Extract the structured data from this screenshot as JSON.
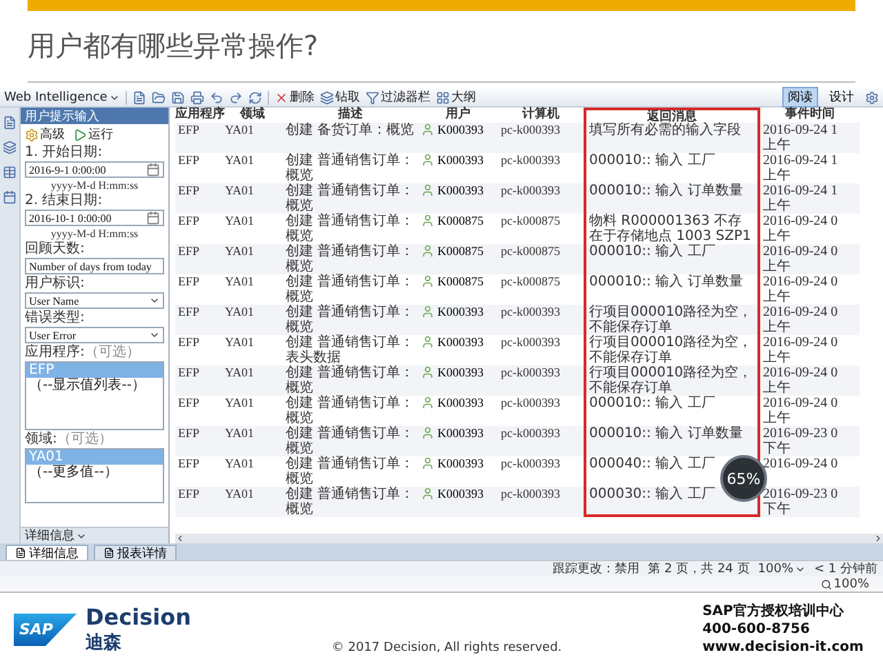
{
  "slide": {
    "title": "用户都有哪些异常操作?"
  },
  "app": {
    "toolbar": {
      "product": "Web Intelligence",
      "actions": [
        "删除",
        "钻取",
        "过滤器栏",
        "大纲"
      ],
      "views": [
        {
          "label": "阅读",
          "selected": true
        },
        {
          "label": "设计",
          "selected": false
        }
      ]
    },
    "prompt_panel": {
      "title": "用户提示输入",
      "buttons": [
        "高级",
        "运行"
      ],
      "date_fields": [
        {
          "label": "1. 开始日期:",
          "value": "2016-9-1 0:00:00",
          "hint": "yyyy-M-d H:mm:ss"
        },
        {
          "label": "2. 结束日期:",
          "value": "2016-10-1 0:00:00",
          "hint": "yyyy-M-d H:mm:ss"
        }
      ],
      "text_field": {
        "label": "回顾天数:",
        "value": "Number of days from today"
      },
      "selects": [
        {
          "label": "用户标识:",
          "value": "User Name"
        },
        {
          "label": "错误类型:",
          "value": "User Error"
        }
      ],
      "lists": [
        {
          "label": "应用程序:",
          "optional": "（可选）",
          "items": [
            {
              "text": "EFP",
              "selected": true
            },
            {
              "text": "（--显示值列表--）",
              "selected": false
            }
          ]
        },
        {
          "label": "领域:",
          "optional": "（可选）",
          "items": [
            {
              "text": "YA01",
              "selected": true
            },
            {
              "text": "（--更多值--）",
              "selected": false
            }
          ]
        }
      ],
      "footer": "详细信息"
    },
    "table": {
      "columns": [
        "应用程序",
        "领域",
        "描述",
        "用户",
        "计算机",
        "返回消息",
        "事件时间"
      ],
      "rows": [
        {
          "app": "EFP",
          "area": "YA01",
          "description": "创建 备货订单：概览",
          "user": "K000393",
          "computer": "pc-k000393",
          "message": "填写所有必需的输入字段",
          "time": "2016-09-24 1\n上午"
        },
        {
          "app": "EFP",
          "area": "YA01",
          "description": "创建 普通销售订单：概览",
          "user": "K000393",
          "computer": "pc-k000393",
          "message": "000010:: 输入 工厂",
          "time": "2016-09-24 1\n上午"
        },
        {
          "app": "EFP",
          "area": "YA01",
          "description": "创建 普通销售订单：概览",
          "user": "K000393",
          "computer": "pc-k000393",
          "message": "000010:: 输入 订单数量",
          "time": "2016-09-24 1\n上午"
        },
        {
          "app": "EFP",
          "area": "YA01",
          "description": "创建 普通销售订单：概览",
          "user": "K000875",
          "computer": "pc-k000875",
          "message": "物料 R000001363 不存在于存储地点 1003 SZP1",
          "time": "2016-09-24 0\n上午"
        },
        {
          "app": "EFP",
          "area": "YA01",
          "description": "创建 普通销售订单：概览",
          "user": "K000875",
          "computer": "pc-k000875",
          "message": "000010:: 输入 工厂",
          "time": "2016-09-24 0\n上午"
        },
        {
          "app": "EFP",
          "area": "YA01",
          "description": "创建 普通销售订单：概览",
          "user": "K000875",
          "computer": "pc-k000875",
          "message": "000010:: 输入 订单数量",
          "time": "2016-09-24 0\n上午"
        },
        {
          "app": "EFP",
          "area": "YA01",
          "description": "创建 普通销售订单：概览",
          "user": "K000393",
          "computer": "pc-k000393",
          "message": "行项目000010路径为空，不能保存订单",
          "time": "2016-09-24 0\n上午"
        },
        {
          "app": "EFP",
          "area": "YA01",
          "description": "创建 普通销售订单：表头数据",
          "user": "K000393",
          "computer": "pc-k000393",
          "message": "行项目000010路径为空，不能保存订单",
          "time": "2016-09-24 0\n上午"
        },
        {
          "app": "EFP",
          "area": "YA01",
          "description": "创建 普通销售订单：概览",
          "user": "K000393",
          "computer": "pc-k000393",
          "message": "行项目000010路径为空，不能保存订单",
          "time": "2016-09-24 0\n上午"
        },
        {
          "app": "EFP",
          "area": "YA01",
          "description": "创建 普通销售订单：概览",
          "user": "K000393",
          "computer": "pc-k000393",
          "message": "000010:: 输入 工厂",
          "time": "2016-09-24 0\n上午"
        },
        {
          "app": "EFP",
          "area": "YA01",
          "description": "创建 普通销售订单：概览",
          "user": "K000393",
          "computer": "pc-k000393",
          "message": "000010:: 输入 订单数量",
          "time": "2016-09-23 0\n下午"
        },
        {
          "app": "EFP",
          "area": "YA01",
          "description": "创建 普通销售订单：概览",
          "user": "K000393",
          "computer": "pc-k000393",
          "message": "000040:: 输入 工厂",
          "time": "2016-09-24 0"
        },
        {
          "app": "EFP",
          "area": "YA01",
          "description": "创建 普通销售订单：概览",
          "user": "K000393",
          "computer": "pc-k000393",
          "message": "000030:: 输入 工厂",
          "time": "2016-09-23 0\n下午"
        }
      ]
    },
    "monitor": "65%",
    "report_tabs": [
      {
        "label": "详细信息",
        "selected": true
      },
      {
        "label": "报表详情",
        "selected": false
      }
    ],
    "status": {
      "tracking": "跟踪更改：禁用",
      "page": "第 2 页，共 24 页",
      "zoom": "100%",
      "refreshed": "< 1 分钟前",
      "page_zoom": "100%"
    }
  },
  "footer": {
    "logo": "SAP",
    "brand": "Decision",
    "brand_cn": "迪森",
    "copyright": "© 2017 Decision, All rights reserved.",
    "contact": [
      "SAP官方授权培训中心",
      "400-600-8756",
      "www.decision-it.com"
    ]
  }
}
